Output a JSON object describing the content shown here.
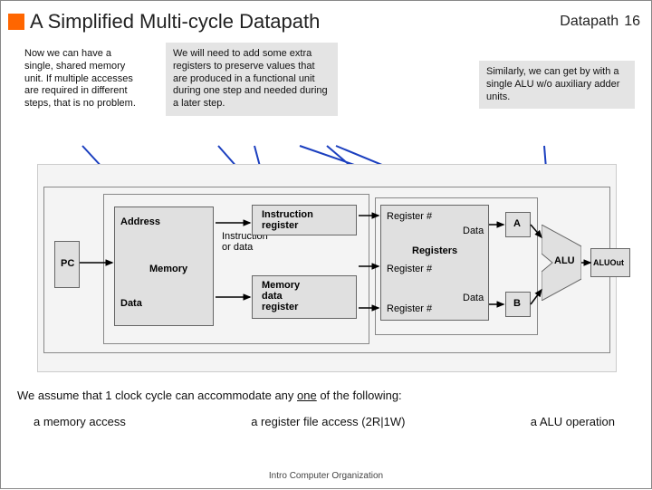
{
  "header": {
    "title": "A Simplified Multi-cycle Datapath",
    "section": "Datapath",
    "page": "16"
  },
  "callouts": {
    "c1": "Now we can have a single, shared memory unit. If multiple accesses are required in different steps, that is no problem.",
    "c2": "We will need to add some extra registers to preserve values that are produced in a functional unit during one step and needed during a later step.",
    "c3": "Similarly, we can get by with a single ALU w/o auxiliary adder units."
  },
  "diagram": {
    "pc": "PC",
    "memory": "Memory",
    "address": "Address",
    "instr_or_data": "Instruction\nor data",
    "data_port": "Data",
    "ir": "Instruction\nregister",
    "mdr": "Memory\ndata\nregister",
    "regs": "Registers",
    "data_lbl": "Data",
    "regno": "Register #",
    "a": "A",
    "b": "B",
    "alu": "ALU",
    "aluout": "ALUOut"
  },
  "bottom": {
    "intro_a": "We assume that 1 clock cycle can accommodate any ",
    "intro_one": "one",
    "intro_b": " of the following:",
    "opt1": "a memory access",
    "opt2": "a register file access (2R|1W)",
    "opt3": "a ALU operation"
  },
  "footer": "Intro Computer Organization"
}
